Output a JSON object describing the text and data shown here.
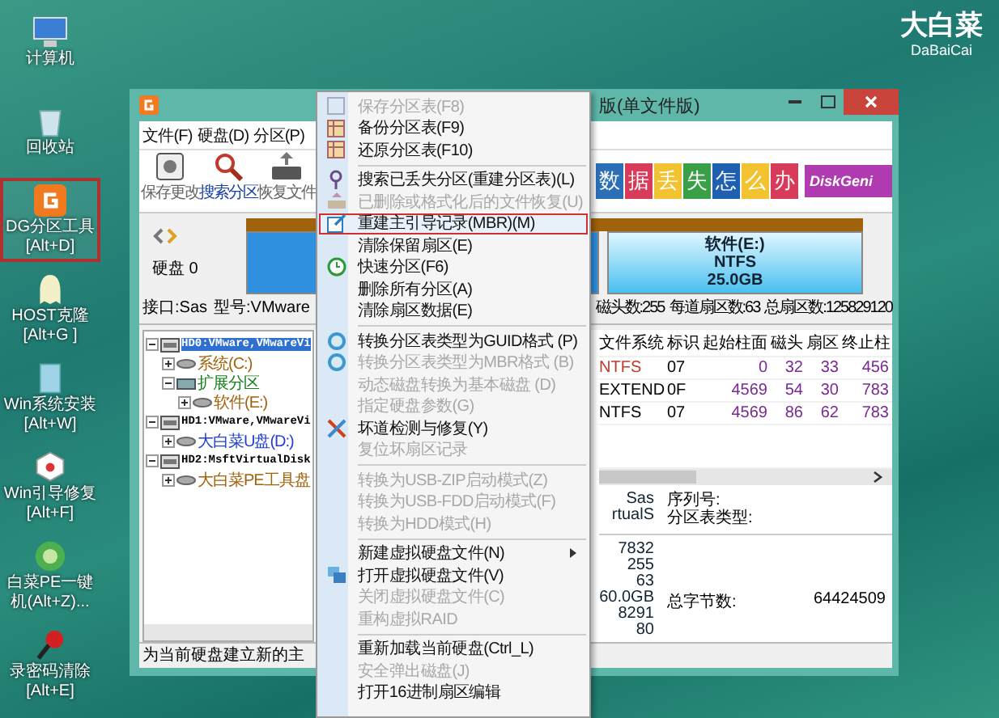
{
  "desktop": {
    "logo": {
      "title": "大白菜",
      "subtitle": "DaBaiCai"
    },
    "icons": [
      {
        "kind": "computer",
        "label": "计算机",
        "selected": false
      },
      {
        "kind": "recycle",
        "label": "回收站",
        "selected": false
      },
      {
        "kind": "partition",
        "label": "DG分区工具",
        "shortcut": "[Alt+D]",
        "selected": true
      },
      {
        "kind": "ghost",
        "label": "HOST克隆",
        "shortcut": "[Alt+G ]",
        "selected": false
      },
      {
        "kind": "install",
        "label": "Win系统安装",
        "shortcut": "[Alt+W]",
        "selected": false
      },
      {
        "kind": "repair",
        "label": "Win引导修复",
        "shortcut": "[Alt+F]",
        "selected": false
      },
      {
        "kind": "pe",
        "label": "白菜PE一键",
        "shortcut": "机(Alt+Z)...",
        "selected": false
      },
      {
        "kind": "password",
        "label": "录密码清除",
        "shortcut": "[Alt+E]",
        "selected": false
      }
    ]
  },
  "window": {
    "title": "版(单文件版)",
    "menus": [
      "文件(F)",
      "硬盘(D)",
      "分区(P)"
    ],
    "toolbar": [
      {
        "kind": "save",
        "label": "保存更改",
        "selected": false
      },
      {
        "kind": "search",
        "label": "搜索分区",
        "selected": true
      },
      {
        "kind": "restore",
        "label": "恢复文件",
        "selected": false
      }
    ],
    "banner": {
      "tiles": [
        "数",
        "据",
        "丢",
        "失",
        "怎",
        "么",
        "办"
      ],
      "brand": "DiskGeni"
    },
    "disk": {
      "name": "硬盘 0",
      "partitions": [
        {
          "kind": "system"
        },
        {
          "kind": "data",
          "name": "软件(E:)",
          "fs": "NTFS",
          "size": "25.0GB"
        }
      ],
      "info_left": [
        "接口:Sas",
        "型号:VMware"
      ],
      "info_right": [
        "磁头数:255",
        "每道扇区数:63",
        "总扇区数:125829120"
      ]
    },
    "tree": [
      {
        "kind": "disk",
        "label": "HD0:VMware,VMwareVi",
        "selected": true,
        "expanded": true,
        "children": [
          {
            "kind": "partition",
            "label": "系统(C:)",
            "color": "#a0620a",
            "selected": false,
            "expanded": false
          },
          {
            "kind": "extended",
            "label": "扩展分区",
            "color": "#17801c",
            "selected": false,
            "expanded": true,
            "children": [
              {
                "kind": "partition",
                "label": "软件(E:)",
                "color": "#a0620a",
                "selected": false,
                "expanded": false
              }
            ]
          }
        ]
      },
      {
        "kind": "disk",
        "label": "HD1:VMware,VMwareVi",
        "selected": false,
        "expanded": true,
        "children": [
          {
            "kind": "partition",
            "label": "大白菜U盘(D:)",
            "color": "#1f3fd0",
            "selected": false,
            "expanded": false
          }
        ]
      },
      {
        "kind": "disk",
        "label": "HD2:MsftVirtualDisk",
        "selected": false,
        "expanded": true,
        "children": [
          {
            "kind": "partition",
            "label": "大白菜PE工具盘",
            "color": "#a0620a",
            "selected": false,
            "expanded": false
          }
        ]
      }
    ],
    "table": {
      "columns": [
        "文件系统",
        "标识",
        "起始柱面",
        "磁头",
        "扇区",
        "终止柱"
      ],
      "rows": [
        {
          "cells": [
            "NTFS",
            "07",
            "0",
            "32",
            "33",
            "456"
          ],
          "color": "#c0392b"
        },
        {
          "cells": [
            "EXTEND",
            "0F",
            "4569",
            "54",
            "30",
            "783"
          ],
          "color": "#000000"
        },
        {
          "cells": [
            "NTFS",
            "07",
            "4569",
            "86",
            "62",
            "783"
          ],
          "color": "#000000"
        }
      ]
    },
    "details": {
      "values_top": [
        "Sas",
        "rtualS"
      ],
      "labels_top": [
        "序列号:",
        "分区表类型:"
      ],
      "values": [
        "7832",
        "255",
        "63",
        "60.0GB",
        "8291",
        "80"
      ],
      "total_label": "总字节数:",
      "total_value": "64424509"
    },
    "status": "为当前硬盘建立新的主"
  },
  "context_menu": {
    "groups": [
      [
        {
          "kind": "save",
          "label": "保存分区表(F8)",
          "disabled": true,
          "selected": false
        },
        {
          "kind": "backup",
          "label": "备份分区表(F9)",
          "disabled": false,
          "selected": false
        },
        {
          "kind": "restore",
          "label": "还原分区表(F10)",
          "disabled": false,
          "selected": false
        }
      ],
      [
        {
          "kind": "search",
          "label": "搜索已丢失分区(重建分区表)(L)",
          "disabled": false,
          "selected": false
        },
        {
          "kind": "recover",
          "label": "已删除或格式化后的文件恢复(U)",
          "disabled": true,
          "selected": false
        },
        {
          "kind": "edit",
          "label": "重建主引导记录(MBR)(M)",
          "disabled": false,
          "selected": true
        },
        {
          "kind": "plain",
          "label": "清除保留扇区(E)",
          "disabled": false,
          "selected": false
        },
        {
          "kind": "clock",
          "label": "快速分区(F6)",
          "disabled": false,
          "selected": false
        },
        {
          "kind": "plain",
          "label": "删除所有分区(A)",
          "disabled": false,
          "selected": false
        },
        {
          "kind": "plain",
          "label": "清除扇区数据(E)",
          "disabled": false,
          "selected": false
        }
      ],
      [
        {
          "kind": "convert",
          "label": "转换分区表类型为GUID格式 (P)",
          "disabled": false,
          "selected": false
        },
        {
          "kind": "convert",
          "label": "转换分区表类型为MBR格式 (B)",
          "disabled": true,
          "selected": false
        },
        {
          "kind": "plain",
          "label": "动态磁盘转换为基本磁盘 (D)",
          "disabled": true,
          "selected": false
        },
        {
          "kind": "plain",
          "label": "指定硬盘参数(G)",
          "disabled": true,
          "selected": false
        },
        {
          "kind": "tools",
          "label": "坏道检测与修复(Y)",
          "disabled": false,
          "selected": false
        },
        {
          "kind": "plain",
          "label": "复位坏扇区记录",
          "disabled": true,
          "selected": false
        }
      ],
      [
        {
          "kind": "plain",
          "label": "转换为USB-ZIP启动模式(Z)",
          "disabled": true,
          "selected": false
        },
        {
          "kind": "plain",
          "label": "转换为USB-FDD启动模式(F)",
          "disabled": true,
          "selected": false
        },
        {
          "kind": "plain",
          "label": "转换为HDD模式(H)",
          "disabled": true,
          "selected": false
        }
      ],
      [
        {
          "kind": "submenu",
          "label": "新建虚拟硬盘文件(N)",
          "disabled": false,
          "selected": false
        },
        {
          "kind": "vdisk",
          "label": "打开虚拟硬盘文件(V)",
          "disabled": false,
          "selected": false
        },
        {
          "kind": "plain",
          "label": "关闭虚拟硬盘文件(C)",
          "disabled": true,
          "selected": false
        },
        {
          "kind": "plain",
          "label": "重构虚拟RAID",
          "disabled": true,
          "selected": false
        }
      ],
      [
        {
          "kind": "plain",
          "label": "重新加载当前硬盘(Ctrl_L)",
          "disabled": false,
          "selected": false
        },
        {
          "kind": "plain",
          "label": "安全弹出磁盘(J)",
          "disabled": true,
          "selected": false
        },
        {
          "kind": "plain",
          "label": "打开16进制扇区编辑",
          "disabled": false,
          "selected": false
        }
      ]
    ]
  }
}
